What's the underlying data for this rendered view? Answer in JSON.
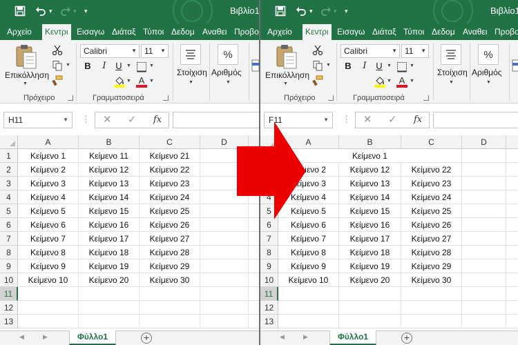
{
  "title": "Βιβλίο1",
  "tabs": [
    "Αρχείο",
    "Κεντρι",
    "Εισαγω",
    "Διάταξ",
    "Τύποι",
    "Δεδομ",
    "Αναθει",
    "Προβο"
  ],
  "ribbon": {
    "paste_label": "Επικόλληση",
    "clipboard_label": "Πρόχειρο",
    "font_name": "Calibri",
    "font_size": "11",
    "bold": "B",
    "italic": "I",
    "underline": "U",
    "font_label": "Γραμματοσειρά",
    "alignment_label": "Στοίχιση",
    "number_label": "Αριθμός",
    "percent": "%"
  },
  "formula_bar": {
    "fx": "fx",
    "left_name": "H11",
    "right_name": "F11"
  },
  "grid": {
    "columns": [
      "A",
      "B",
      "C",
      "D"
    ],
    "rows": [
      "1",
      "2",
      "3",
      "4",
      "5",
      "6",
      "7",
      "8",
      "9",
      "10",
      "11",
      "12",
      "13"
    ],
    "selected_row": "11",
    "left_data": [
      [
        "Κείμενο 1",
        "Κείμενο 11",
        "Κείμενο 21"
      ],
      [
        "Κείμενο 2",
        "Κείμενο 12",
        "Κείμενο 22"
      ],
      [
        "Κείμενο 3",
        "Κείμενο 13",
        "Κείμενο 23"
      ],
      [
        "Κείμενο 4",
        "Κείμενο 14",
        "Κείμενο 24"
      ],
      [
        "Κείμενο 5",
        "Κείμενο 15",
        "Κείμενο 25"
      ],
      [
        "Κείμενο 6",
        "Κείμενο 16",
        "Κείμενο 26"
      ],
      [
        "Κείμενο 7",
        "Κείμενο 17",
        "Κείμενο 27"
      ],
      [
        "Κείμενο 8",
        "Κείμενο 18",
        "Κείμενο 28"
      ],
      [
        "Κείμενο 9",
        "Κείμενο 19",
        "Κείμενο 29"
      ],
      [
        "Κείμενο 10",
        "Κείμενο 20",
        "Κείμενο 30"
      ]
    ],
    "right_merged": "Κείμενο 1",
    "right_data": [
      [
        "Κείμενο 2",
        "Κείμενο 12",
        "Κείμενο 22"
      ],
      [
        "Κείμενο 3",
        "Κείμενο 13",
        "Κείμενο 23"
      ],
      [
        "Κείμενο 4",
        "Κείμενο 14",
        "Κείμενο 24"
      ],
      [
        "Κείμενο 5",
        "Κείμενο 15",
        "Κείμενο 25"
      ],
      [
        "Κείμενο 6",
        "Κείμενο 16",
        "Κείμενο 26"
      ],
      [
        "Κείμενο 7",
        "Κείμενο 17",
        "Κείμενο 27"
      ],
      [
        "Κείμενο 8",
        "Κείμενο 18",
        "Κείμενο 28"
      ],
      [
        "Κείμενο 9",
        "Κείμενο 19",
        "Κείμενο 29"
      ],
      [
        "Κείμενο 10",
        "Κείμενο 20",
        "Κείμενο 30"
      ]
    ]
  },
  "sheet": {
    "tab": "Φύλλο1",
    "add": "+"
  },
  "icons": {
    "save": "save-icon",
    "undo": "undo-icon",
    "redo": "redo-icon",
    "paste": "clipboard-paste-icon",
    "cut": "scissors-icon",
    "copy": "copy-icon",
    "format_painter": "format-painter-icon",
    "highlight": "fill-color-icon",
    "font_color": "font-color-icon",
    "align": "align-lines-icon",
    "cancel": "x-icon",
    "confirm": "check-icon",
    "add_sheet": "plus-circle-icon",
    "arrow": "right-arrow-icon"
  },
  "colors": {
    "excel_green": "#217346",
    "arrow_red": "#ee0000",
    "highlight_yellow": "#ffff00",
    "font_red": "#e81123"
  }
}
